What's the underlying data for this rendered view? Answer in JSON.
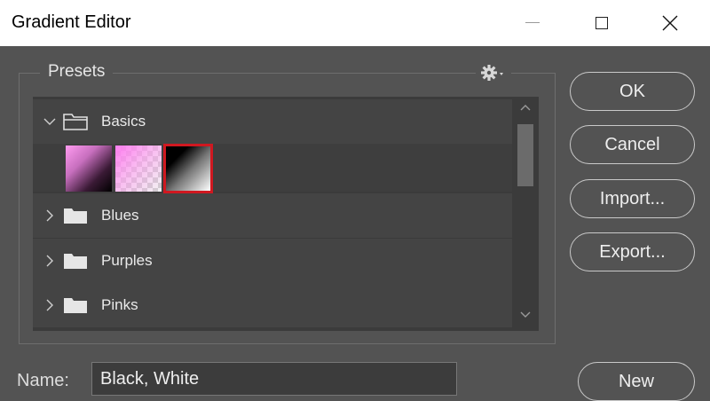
{
  "window": {
    "title": "Gradient Editor"
  },
  "presets": {
    "legend": "Presets",
    "settings_icon": "gear-icon",
    "groups": [
      {
        "label": "Basics",
        "expanded": true
      },
      {
        "label": "Blues",
        "expanded": false
      },
      {
        "label": "Purples",
        "expanded": false
      },
      {
        "label": "Pinks",
        "expanded": false
      }
    ],
    "swatches": [
      {
        "id": "pink-to-black",
        "selected": false
      },
      {
        "id": "pink-to-transparent",
        "selected": false
      },
      {
        "id": "black-to-white",
        "selected": true
      }
    ]
  },
  "buttons": {
    "ok": "OK",
    "cancel": "Cancel",
    "import": "Import...",
    "export": "Export...",
    "new": "New"
  },
  "name_field": {
    "label": "Name:",
    "value": "Black, White"
  },
  "colors": {
    "dialog_bg": "#535353",
    "list_bg": "#444444",
    "selection_border": "#d01820"
  }
}
